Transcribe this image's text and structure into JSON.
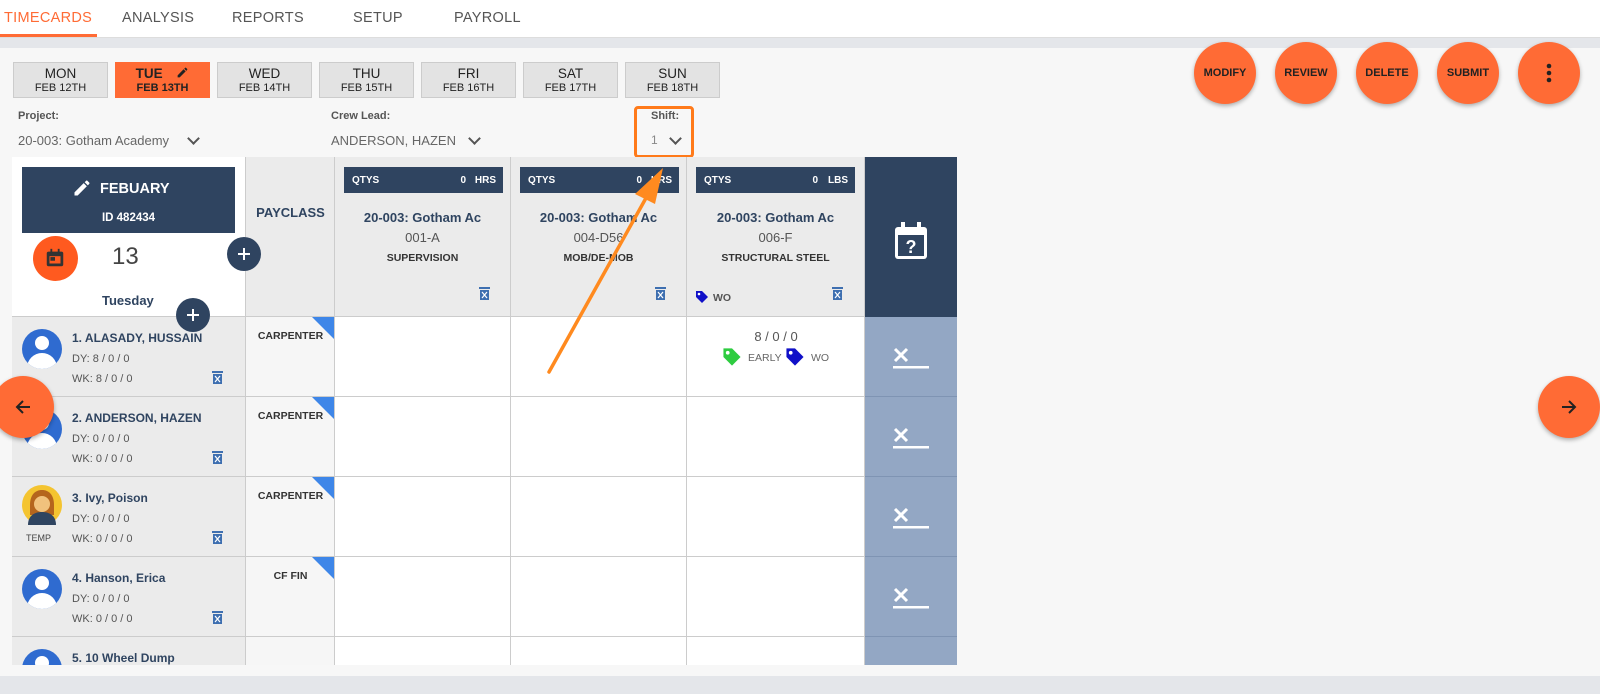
{
  "nav": {
    "items": [
      "TIMECARDS",
      "ANALYSIS",
      "REPORTS",
      "SETUP",
      "PAYROLL"
    ],
    "active": "TIMECARDS"
  },
  "days": [
    {
      "name": "MON",
      "date": "FEB 12TH"
    },
    {
      "name": "TUE",
      "date": "FEB 13TH"
    },
    {
      "name": "WED",
      "date": "FEB 14TH"
    },
    {
      "name": "THU",
      "date": "FEB 15TH"
    },
    {
      "name": "FRI",
      "date": "FEB 16TH"
    },
    {
      "name": "SAT",
      "date": "FEB 17TH"
    },
    {
      "name": "SUN",
      "date": "FEB 18TH"
    }
  ],
  "actions": {
    "modify": "MODIFY",
    "review": "REVIEW",
    "delete": "DELETE",
    "submit": "SUBMIT"
  },
  "filters": {
    "project_label": "Project:",
    "project_value": "20-003: Gotham Academy",
    "crew_label": "Crew Lead:",
    "crew_value": "ANDERSON, HAZEN",
    "shift_label": "Shift:",
    "shift_value": "1"
  },
  "card": {
    "month": "FEBUARY",
    "id": "ID 482434",
    "day_number": "13",
    "weekday": "Tuesday"
  },
  "payclass_header": "PAYCLASS",
  "columns": [
    {
      "qty_label": "QTYS",
      "qty": "0",
      "unit": "HRS",
      "title": "20-003: Gotham Ac",
      "code": "001-A",
      "desc": "SUPERVISION",
      "tag": ""
    },
    {
      "qty_label": "QTYS",
      "qty": "0",
      "unit": "HRS",
      "title": "20-003: Gotham Ac",
      "code": "004-D56",
      "desc": "MOB/DE-MOB",
      "tag": ""
    },
    {
      "qty_label": "QTYS",
      "qty": "0",
      "unit": "LBS",
      "title": "20-003: Gotham Ac",
      "code": "006-F",
      "desc": "STRUCTURAL STEEL",
      "tag": "WO"
    }
  ],
  "rows": [
    {
      "name": "1. ALASADY, HUSSAIN",
      "dy": "DY: 8 / 0 / 0",
      "wk": "WK: 8 / 0 / 0",
      "payclass": "CARPENTER",
      "temp": ""
    },
    {
      "name": "2. ANDERSON, HAZEN",
      "dy": "DY: 0 / 0 / 0",
      "wk": "WK: 0 / 0 / 0",
      "payclass": "CARPENTER",
      "temp": ""
    },
    {
      "name": "3. Ivy, Poison",
      "dy": "DY: 0 / 0 / 0",
      "wk": "WK: 0 / 0 / 0",
      "payclass": "CARPENTER",
      "temp": "TEMP"
    },
    {
      "name": "4. Hanson, Erica",
      "dy": "DY: 0 / 0 / 0",
      "wk": "WK: 0 / 0 / 0",
      "payclass": "CF FIN",
      "temp": ""
    },
    {
      "name": "5. 10 Wheel Dump",
      "dy": "",
      "wk": "",
      "payclass": "",
      "temp": ""
    }
  ],
  "entry": {
    "value": "8 / 0 / 0",
    "tag1": "EARLY",
    "tag2": "WO"
  },
  "colors": {
    "accent": "#ff6b35",
    "navy": "#2f4460",
    "xcell": "#93a7c4",
    "tag_green": "#2ecc40",
    "tag_blue": "#1010c8",
    "highlight": "#ff7a1a"
  }
}
